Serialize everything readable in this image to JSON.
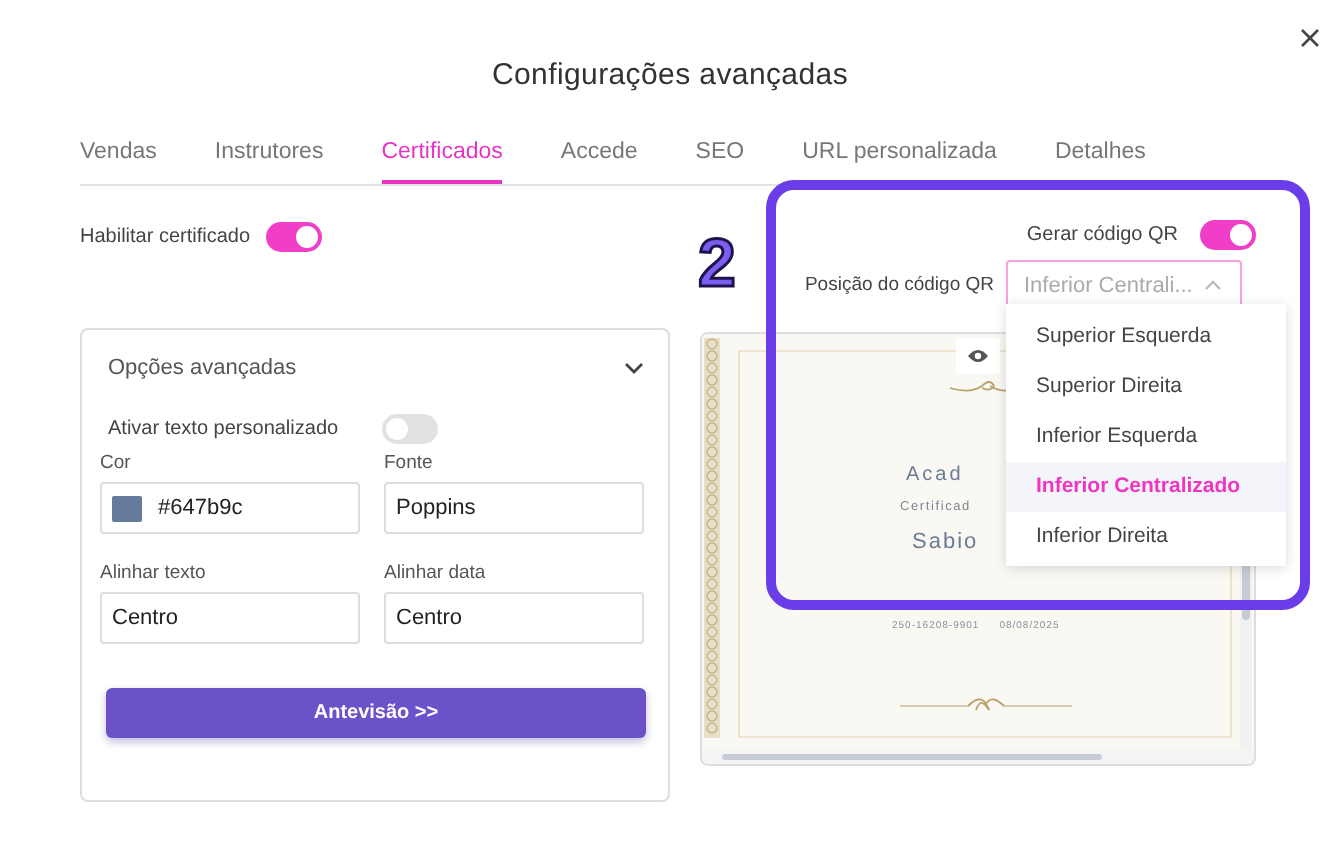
{
  "dialog": {
    "title": "Configurações avançadas"
  },
  "tabs": [
    {
      "label": "Vendas",
      "selected": false
    },
    {
      "label": "Instrutores",
      "selected": false
    },
    {
      "label": "Certificados",
      "selected": true
    },
    {
      "label": "Accede",
      "selected": false
    },
    {
      "label": "SEO",
      "selected": false
    },
    {
      "label": "URL personalizada",
      "selected": false
    },
    {
      "label": "Detalhes",
      "selected": false
    }
  ],
  "enable_certificate": {
    "label": "Habilitar certificado",
    "on": true
  },
  "advanced_options": {
    "title": "Opções avançadas",
    "expanded": true,
    "custom_text": {
      "label": "Ativar texto personalizado",
      "on": false
    },
    "fields": [
      {
        "label": "Cor",
        "value": "#647b9c",
        "kind": "color"
      },
      {
        "label": "Fonte",
        "value": "Poppins",
        "kind": "text"
      },
      {
        "label": "Alinhar texto",
        "value": "Centro",
        "kind": "text"
      },
      {
        "label": "Alinhar data",
        "value": "Centro",
        "kind": "text"
      }
    ],
    "button": "Antevisão >>"
  },
  "qr": {
    "label": "Gerar código QR",
    "on": true,
    "position_label": "Posição do código QR",
    "position_value": "Inferior Centrali...",
    "options": [
      {
        "label": "Superior Esquerda",
        "selected": false
      },
      {
        "label": "Superior Direita",
        "selected": false
      },
      {
        "label": "Inferior Esquerda",
        "selected": false
      },
      {
        "label": "Inferior Centralizado",
        "selected": true
      },
      {
        "label": "Inferior Direita",
        "selected": false
      }
    ]
  },
  "certificate_preview": {
    "lines": [
      "Acad",
      "Certificad",
      "Sabio"
    ],
    "code": "250-16208-9901",
    "date": "08/08/2025"
  },
  "annotation": {
    "label": "2"
  }
}
